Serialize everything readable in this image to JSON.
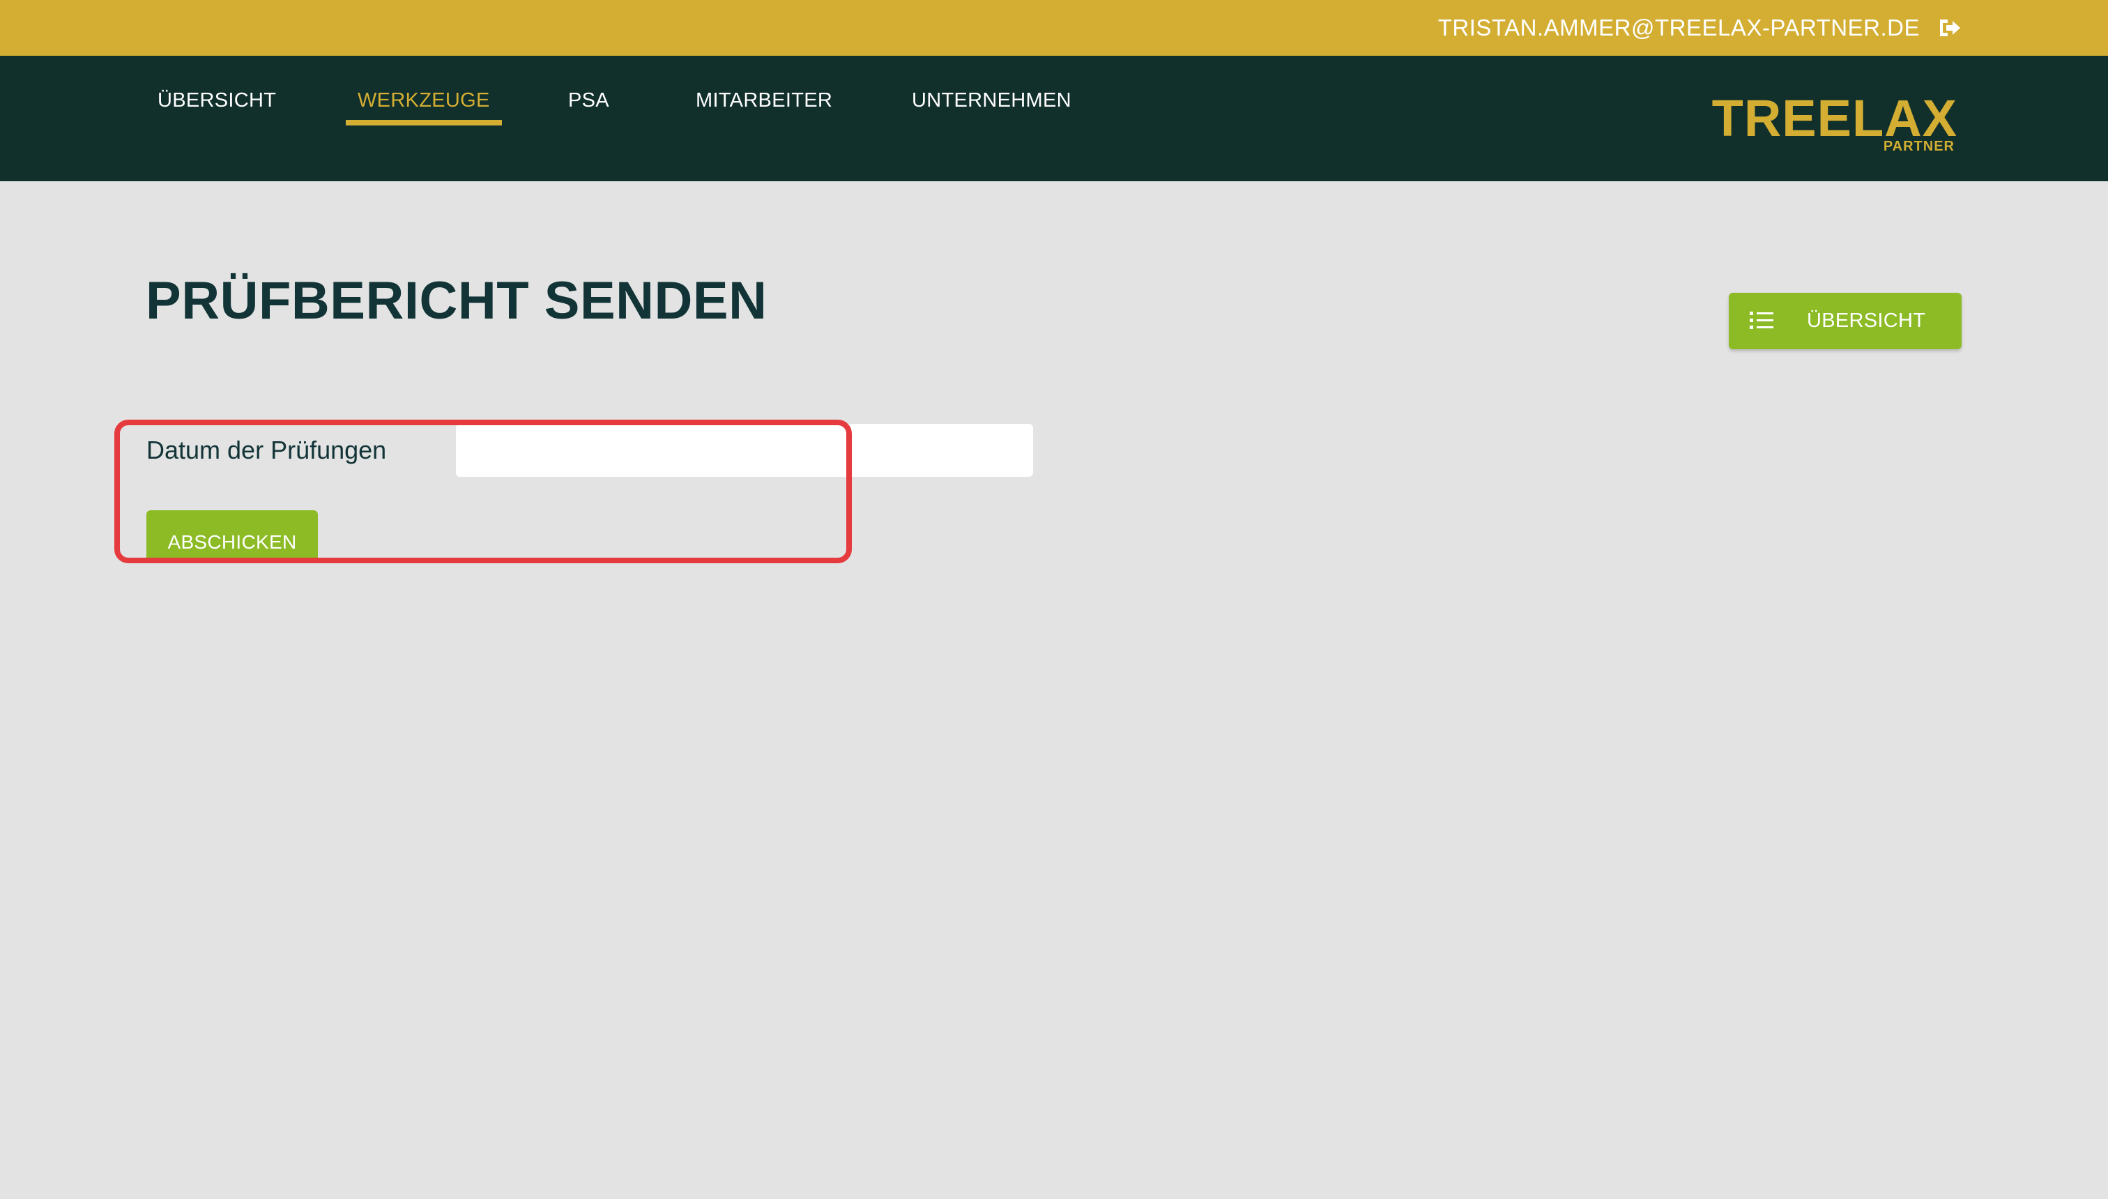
{
  "topbar": {
    "user_email": "TRISTAN.AMMER@TREELAX-PARTNER.DE",
    "logout_icon": "sign-out-icon"
  },
  "nav": {
    "items": [
      {
        "label": "ÜBERSICHT",
        "active": false
      },
      {
        "label": "WERKZEUGE",
        "active": true
      },
      {
        "label": "PSA",
        "active": false
      },
      {
        "label": "MITARBEITER",
        "active": false
      },
      {
        "label": "UNTERNEHMEN",
        "active": false
      }
    ]
  },
  "logo": {
    "main": "TREELAX",
    "sub": "PARTNER"
  },
  "page": {
    "title": "PRÜFBERICHT SENDEN",
    "overview_button": {
      "label": "ÜBERSICHT",
      "icon": "list-icon"
    }
  },
  "form": {
    "date_label": "Datum der Prüfungen",
    "date_value": "",
    "submit_label": "ABSCHICKEN"
  },
  "colors": {
    "topbar": "#d3ae33",
    "navbar": "#112f2b",
    "accent_gold": "#d3ae33",
    "button_green": "#8cbb26",
    "page_bg": "#e3e3e3",
    "title_text": "#123437",
    "highlight": "#e63b3e"
  }
}
